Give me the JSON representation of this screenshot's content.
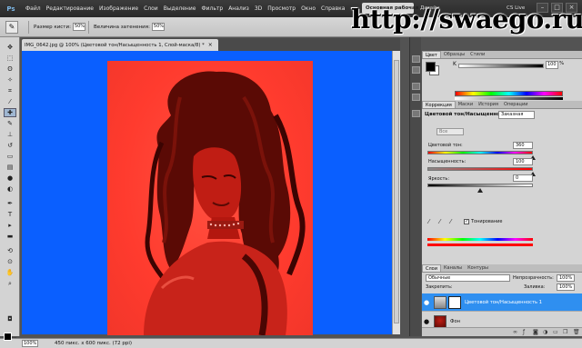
{
  "app": {
    "logo": "Ps",
    "menu": [
      "Файл",
      "Редактирование",
      "Изображение",
      "Слои",
      "Выделение",
      "Фильтр",
      "Анализ",
      "3D",
      "Просмотр",
      "Окно",
      "Справка"
    ],
    "zoom": "100%",
    "workspace_active": "Основная рабочая среда",
    "workspace_design": "Дизайн",
    "cs_live": "CS Live",
    "watermark": "http://swaego.ru",
    "win_min": "–",
    "win_max": "□",
    "win_close": "×"
  },
  "options": {
    "size_label": "Размер кисти:",
    "size_value": "50%",
    "feather_label": "Величина затенения:",
    "feather_value": "50%"
  },
  "document": {
    "tab_title": "IMG_0642.jpg @ 100% (Цветовой тон/Насыщенность 1, Слой-маска/8) *",
    "close": "×"
  },
  "status": {
    "zoom": "100%",
    "info": "450 пикс. x 600 пикс. (72 ppi)"
  },
  "color_panel": {
    "tabs": [
      "Цвет",
      "Образцы",
      "Стили"
    ],
    "channel": "K",
    "value": "100",
    "unit": "%"
  },
  "adjustments": {
    "tabs": [
      "Коррекция",
      "Маски",
      "История",
      "Операции"
    ],
    "title": "Цветовой тон/Насыщенность",
    "preset": "Заказная",
    "channel": "Все",
    "hue_label": "Цветовой тон:",
    "hue_value": "360",
    "hue_level": 1.0,
    "saturation_label": "Насыщенность:",
    "saturation_value": "100",
    "saturation_level": 1.0,
    "lightness_label": "Яркость:",
    "lightness_value": "0",
    "lightness_level": 0.5,
    "colorize_label": "Тонирование",
    "colorize_checked": true
  },
  "layers": {
    "tabs": [
      "Слои",
      "Каналы",
      "Контуры"
    ],
    "blend_mode": "Обычные",
    "opacity_label": "Непрозрачность:",
    "opacity_value": "100%",
    "lock_label": "Закрепить:",
    "fill_label": "Заливка:",
    "fill_value": "100%",
    "items": [
      {
        "name": "Цветовой тон/Насыщенность 1",
        "selected": true
      },
      {
        "name": "Фон",
        "selected": false
      }
    ]
  },
  "colors": {
    "canvas_bg": "#0a5fff",
    "photo_tint": "#ff3b2e",
    "selection": "#2f8ff0"
  }
}
